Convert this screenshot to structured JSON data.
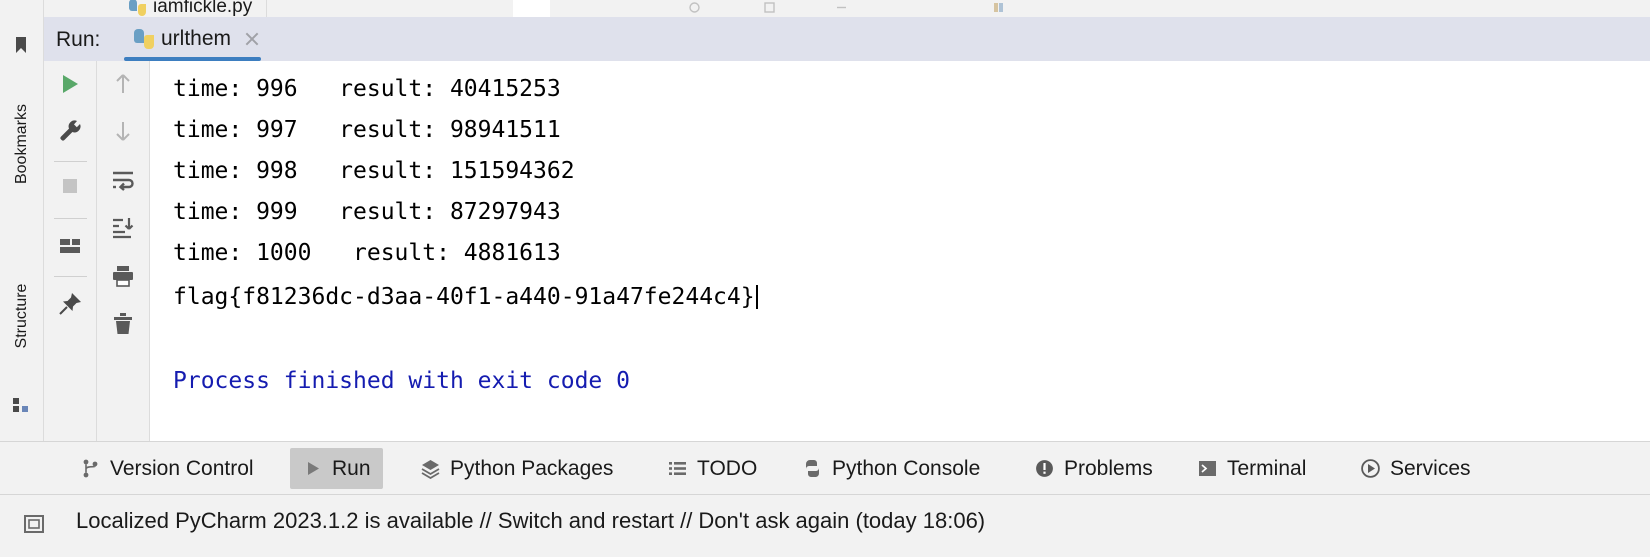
{
  "editor": {
    "tab_filename": "iamfickle.py",
    "tab_icon": "python-file-icon"
  },
  "left_stripe": {
    "bookmarks_label": "Bookmarks",
    "structure_label": "Structure",
    "bookmark_icon": "bookmark-icon",
    "structure_icon": "structure-icon"
  },
  "run_panel": {
    "run_label": "Run:",
    "config_name": "urlthem",
    "config_icon": "python-run-config-icon",
    "close_icon": "close-icon",
    "accent_color": "#3d7ec0",
    "header_bg": "#dfe1ec",
    "toolbar_left": [
      {
        "name": "rerun-button",
        "icon": "play-icon"
      },
      {
        "name": "edit-configurations-button",
        "icon": "wrench-icon"
      },
      {
        "name": "stop-button",
        "icon": "stop-icon"
      },
      {
        "name": "layout-settings-button",
        "icon": "layout-icon"
      },
      {
        "name": "pin-tab-button",
        "icon": "pin-icon"
      }
    ],
    "toolbar_right": [
      {
        "name": "previous-occurrence-button",
        "icon": "arrow-up-icon"
      },
      {
        "name": "next-occurrence-button",
        "icon": "arrow-down-icon"
      },
      {
        "name": "soft-wrap-button",
        "icon": "soft-wrap-icon"
      },
      {
        "name": "scroll-to-end-button",
        "icon": "scroll-to-end-icon"
      },
      {
        "name": "print-button",
        "icon": "print-icon"
      },
      {
        "name": "clear-all-button",
        "icon": "trash-icon"
      }
    ]
  },
  "console": {
    "lines": [
      "time: 996   result: 40415253",
      "time: 997   result: 98941511",
      "time: 998   result: 151594362",
      "time: 999   result: 87297943",
      "time: 1000   result: 4881613",
      "flag{f81236dc-d3aa-40f1-a440-91a47fe244c4}"
    ],
    "process_finished": "Process finished with exit code 0",
    "finished_color": "#151cb0"
  },
  "bottom_tabs": [
    {
      "label": "Version Control",
      "icon": "branch-icon",
      "active": false
    },
    {
      "label": "Run",
      "icon": "play-icon",
      "active": true
    },
    {
      "label": "Python Packages",
      "icon": "packages-icon",
      "active": false
    },
    {
      "label": "TODO",
      "icon": "list-icon",
      "active": false
    },
    {
      "label": "Python Console",
      "icon": "python-console-icon",
      "active": false
    },
    {
      "label": "Problems",
      "icon": "warning-icon",
      "active": false
    },
    {
      "label": "Terminal",
      "icon": "terminal-icon",
      "active": false
    },
    {
      "label": "Services",
      "icon": "services-icon",
      "active": false
    }
  ],
  "status_bar": {
    "icon": "notification-icon",
    "message": "Localized PyCharm 2023.1.2 is available // Switch and restart // Don't ask again (today 18:06)"
  }
}
